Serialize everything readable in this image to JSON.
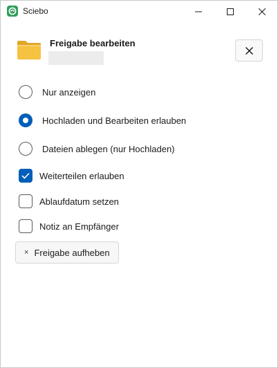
{
  "window": {
    "title": "Sciebo",
    "app_icon": "sciebo-logo-icon",
    "controls": [
      "minimize-icon",
      "maximize-icon",
      "close-icon"
    ]
  },
  "header": {
    "title": "Freigabe bearbeiten",
    "folder_icon": "folder-icon",
    "close_button_icon": "close-icon"
  },
  "permissions": {
    "options": [
      {
        "label": "Nur anzeigen",
        "selected": false
      },
      {
        "label": "Hochladen und Bearbeiten erlauben",
        "selected": true
      },
      {
        "label": "Dateien ablegen (nur Hochladen)",
        "selected": false
      }
    ]
  },
  "settings": {
    "allow_reshare": {
      "label": "Weiterteilen erlauben",
      "checked": true
    },
    "set_expiry": {
      "label": "Ablaufdatum setzen",
      "checked": false
    },
    "note_to_recipient": {
      "label": "Notiz an Empfänger",
      "checked": false
    }
  },
  "actions": {
    "unshare_label": "Freigabe aufheben",
    "unshare_icon_glyph": "×"
  },
  "colors": {
    "accent": "#005fb8",
    "folder": "#f5c242",
    "brand": "#2f9e5b"
  }
}
